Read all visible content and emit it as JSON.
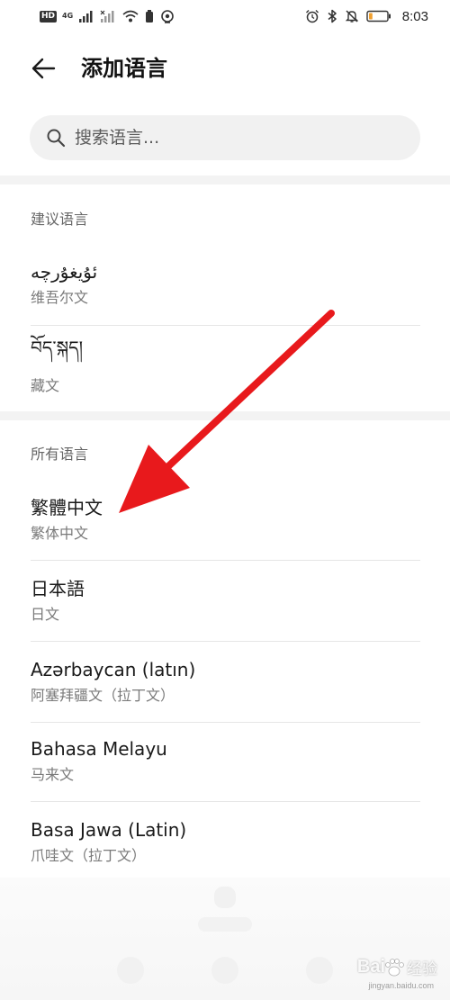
{
  "status_bar": {
    "left_badges": [
      "HD",
      "4G"
    ],
    "icons_left": [
      "signal-icon",
      "signal-x-icon",
      "wifi-icon",
      "battery-saver-icon",
      "hotspot-icon"
    ],
    "icons_right": [
      "alarm-icon",
      "bluetooth-icon",
      "mute-icon",
      "battery-icon"
    ],
    "time": "8:03",
    "battery_level": 0.2,
    "battery_color": "#f0a030"
  },
  "header": {
    "back_icon": "arrow-left-icon",
    "title": "添加语言"
  },
  "search": {
    "icon": "search-icon",
    "placeholder": "搜索语言..."
  },
  "suggested": {
    "header": "建议语言",
    "items": [
      {
        "name": "ئۇيغۇرچە",
        "sub": "维吾尔文"
      },
      {
        "name": "བོད་སྐད།",
        "sub": "藏文"
      }
    ]
  },
  "all": {
    "header": "所有语言",
    "items": [
      {
        "name": "繁體中文",
        "sub": "繁体中文"
      },
      {
        "name": "日本語",
        "sub": "日文"
      },
      {
        "name": "Azərbaycan (latın)",
        "sub": "阿塞拜疆文（拉丁文）"
      },
      {
        "name": "Bahasa Melayu",
        "sub": "马来文"
      },
      {
        "name": "Basa Jawa (Latin)",
        "sub": "爪哇文（拉丁文）"
      }
    ]
  },
  "overlay": {
    "arrow_color": "#e8191c"
  },
  "watermark": {
    "brand": "Bai",
    "brand_suffix": "经验",
    "url": "jingyan.baidu.com"
  }
}
